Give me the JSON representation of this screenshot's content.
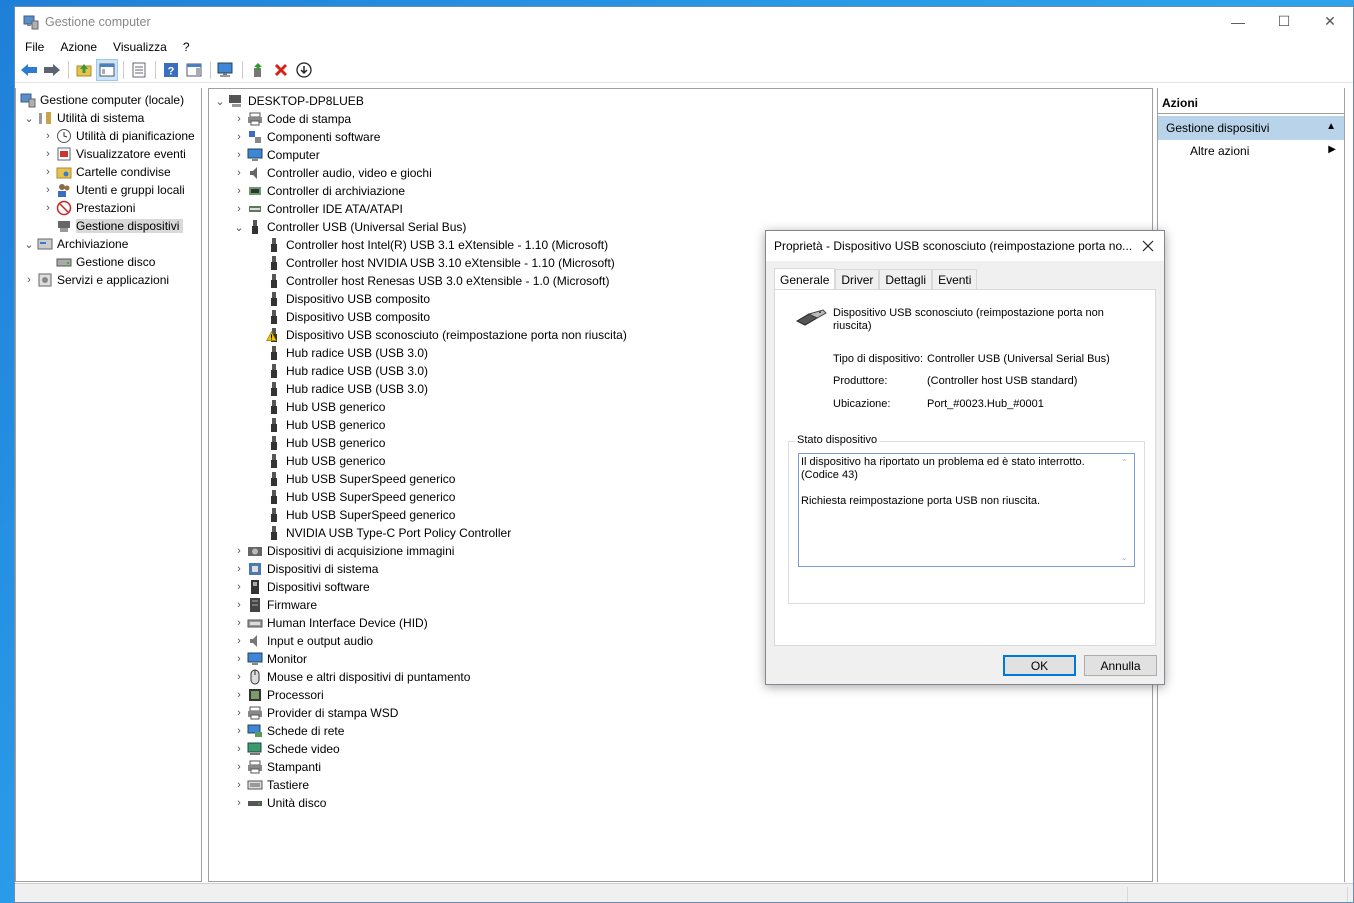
{
  "window": {
    "title": "Gestione computer",
    "controls": {
      "minimize": "—",
      "maximize": "☐",
      "close": "✕"
    }
  },
  "menu": [
    "File",
    "Azione",
    "Visualizza",
    "?"
  ],
  "left_tree": [
    {
      "label": "Gestione computer (locale)",
      "chev": "",
      "icon": "computer-management-icon"
    },
    {
      "label": "Utilità di sistema",
      "chev": "⌄",
      "icon": "tools-icon"
    },
    {
      "label": "Utilità di pianificazione",
      "chev": "›",
      "icon": "clock-icon"
    },
    {
      "label": "Visualizzatore eventi",
      "chev": "›",
      "icon": "event-viewer-icon"
    },
    {
      "label": "Cartelle condivise",
      "chev": "›",
      "icon": "shared-folder-icon"
    },
    {
      "label": "Utenti e gruppi locali",
      "chev": "›",
      "icon": "users-icon"
    },
    {
      "label": "Prestazioni",
      "chev": "›",
      "icon": "performance-icon"
    },
    {
      "label": "Gestione dispositivi",
      "chev": "",
      "icon": "device-manager-icon",
      "selected": true
    },
    {
      "label": "Archiviazione",
      "chev": "⌄",
      "icon": "storage-icon"
    },
    {
      "label": "Gestione disco",
      "chev": "",
      "icon": "disk-icon"
    },
    {
      "label": "Servizi e applicazioni",
      "chev": "›",
      "icon": "services-icon"
    }
  ],
  "device_tree": {
    "root": "DESKTOP-DP8LUEB",
    "categories_before": [
      {
        "label": "Code di stampa",
        "icon": "printer-icon"
      },
      {
        "label": "Componenti software",
        "icon": "software-icon"
      },
      {
        "label": "Computer",
        "icon": "monitor-icon"
      },
      {
        "label": "Controller audio, video e giochi",
        "icon": "speaker-icon"
      },
      {
        "label": "Controller di archiviazione",
        "icon": "storage-controller-icon"
      },
      {
        "label": "Controller IDE ATA/ATAPI",
        "icon": "ide-icon"
      }
    ],
    "usb_category": "Controller USB (Universal Serial Bus)",
    "usb_devices": [
      {
        "label": "Controller host Intel(R) USB 3.1 eXtensible - 1.10 (Microsoft)",
        "warn": false
      },
      {
        "label": "Controller host NVIDIA USB 3.10 eXtensible - 1.10 (Microsoft)",
        "warn": false
      },
      {
        "label": "Controller host Renesas USB 3.0 eXtensible - 1.0 (Microsoft)",
        "warn": false
      },
      {
        "label": "Dispositivo USB composito",
        "warn": false
      },
      {
        "label": "Dispositivo USB composito",
        "warn": false
      },
      {
        "label": "Dispositivo USB sconosciuto (reimpostazione porta non riuscita)",
        "warn": true
      },
      {
        "label": "Hub radice USB (USB 3.0)",
        "warn": false
      },
      {
        "label": "Hub radice USB (USB 3.0)",
        "warn": false
      },
      {
        "label": "Hub radice USB (USB 3.0)",
        "warn": false
      },
      {
        "label": "Hub USB generico",
        "warn": false
      },
      {
        "label": "Hub USB generico",
        "warn": false
      },
      {
        "label": "Hub USB generico",
        "warn": false
      },
      {
        "label": "Hub USB generico",
        "warn": false
      },
      {
        "label": "Hub USB SuperSpeed generico",
        "warn": false
      },
      {
        "label": "Hub USB SuperSpeed generico",
        "warn": false
      },
      {
        "label": "Hub USB SuperSpeed generico",
        "warn": false
      },
      {
        "label": "NVIDIA USB Type-C Port Policy Controller",
        "warn": false
      }
    ],
    "categories_after": [
      {
        "label": "Dispositivi di acquisizione immagini",
        "icon": "camera-icon"
      },
      {
        "label": "Dispositivi di sistema",
        "icon": "system-device-icon"
      },
      {
        "label": "Dispositivi software",
        "icon": "software-device-icon"
      },
      {
        "label": "Firmware",
        "icon": "firmware-icon"
      },
      {
        "label": "Human Interface Device (HID)",
        "icon": "hid-icon"
      },
      {
        "label": "Input e output audio",
        "icon": "audio-io-icon"
      },
      {
        "label": "Monitor",
        "icon": "monitor-icon"
      },
      {
        "label": "Mouse e altri dispositivi di puntamento",
        "icon": "mouse-icon"
      },
      {
        "label": "Processori",
        "icon": "processor-icon"
      },
      {
        "label": "Provider di stampa WSD",
        "icon": "printer-icon"
      },
      {
        "label": "Schede di rete",
        "icon": "network-icon"
      },
      {
        "label": "Schede video",
        "icon": "display-adapter-icon"
      },
      {
        "label": "Stampanti",
        "icon": "printer-icon"
      },
      {
        "label": "Tastiere",
        "icon": "keyboard-icon"
      },
      {
        "label": "Unità disco",
        "icon": "disk-drive-icon"
      }
    ]
  },
  "actions": {
    "header": "Azioni",
    "section": "Gestione dispositivi",
    "item": "Altre azioni"
  },
  "dialog": {
    "title": "Proprietà - Dispositivo USB sconosciuto (reimpostazione porta no...",
    "tabs": [
      "Generale",
      "Driver",
      "Dettagli",
      "Eventi"
    ],
    "device_name": "Dispositivo USB sconosciuto (reimpostazione porta non riuscita)",
    "props": [
      {
        "label": "Tipo di dispositivo:",
        "value": "Controller USB (Universal Serial Bus)"
      },
      {
        "label": "Produttore:",
        "value": "(Controller host USB standard)"
      },
      {
        "label": "Ubicazione:",
        "value": "Port_#0023.Hub_#0001"
      }
    ],
    "status_group": "Stato dispositivo",
    "status_line1": "Il dispositivo ha riportato un problema ed è stato interrotto. (Codice 43)",
    "status_line2": "Richiesta reimpostazione porta USB non riuscita.",
    "ok": "OK",
    "cancel": "Annulla"
  },
  "colors": {
    "accent": "#0078d7",
    "selection": "#d9d9d9",
    "action_section": "#b8d3ea",
    "warning": "#f4c20d"
  }
}
